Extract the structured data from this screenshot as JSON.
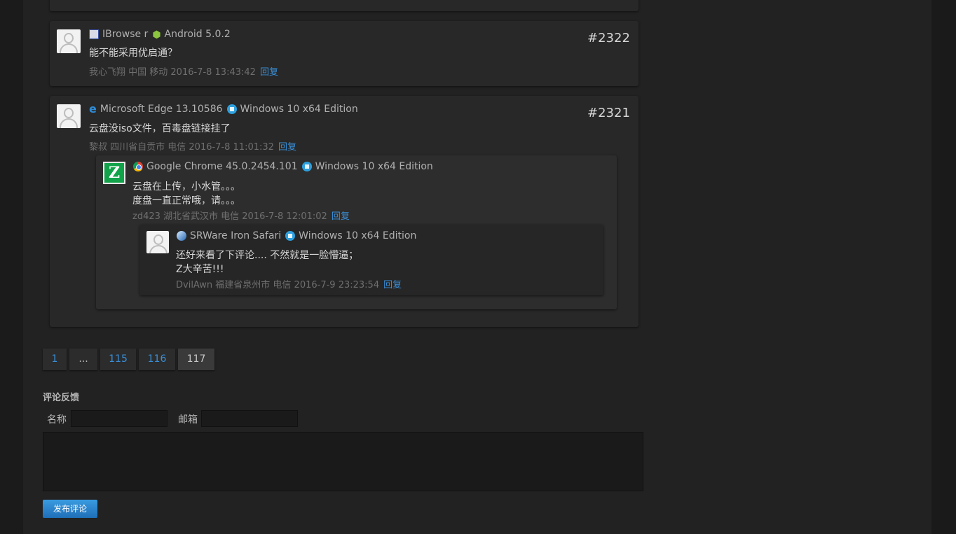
{
  "comments": {
    "c2322": {
      "browser": "IBrowse r",
      "os": "Android 5.0.2",
      "text": "能不能采用优启通？",
      "author_meta": "我心飞翔 中国 移动 2016-7-8 13:43:42",
      "reply": "回复",
      "number": "#2322"
    },
    "c2321": {
      "browser": "Microsoft Edge 13.10586",
      "os": "Windows 10 x64 Edition",
      "text": "云盘没iso文件，百毒盘链接挂了",
      "author_meta": "黎叔 四川省自贡市 电信 2016-7-8 11:01:32",
      "reply": "回复",
      "number": "#2321"
    },
    "reply1": {
      "browser": "Google Chrome 45.0.2454.101",
      "os": "Windows 10 x64 Edition",
      "text_line1": "云盘在上传，小水管。。。",
      "text_line2": "度盘一直正常哦，请。。。",
      "author_meta": "zd423 湖北省武汉市 电信 2016-7-8 12:01:02",
      "reply": "回复",
      "avatar_letter": "Z"
    },
    "reply2": {
      "browser": "SRWare Iron Safari",
      "os": "Windows 10 x64 Edition",
      "text_line1": "还好来看了下评论.... 不然就是一脸懵逼；",
      "text_line2": "Z大辛苦!!!",
      "author_meta": "DvilAwn 福建省泉州市 电信 2016-7-9 23:23:54",
      "reply": "回复"
    }
  },
  "pagination": {
    "p1": "1",
    "dots": "...",
    "p115": "115",
    "p116": "116",
    "p117": "117",
    "current": "117"
  },
  "form": {
    "title": "评论反馈",
    "name_label": "名称",
    "email_label": "邮箱",
    "submit_label": "发布评论"
  }
}
